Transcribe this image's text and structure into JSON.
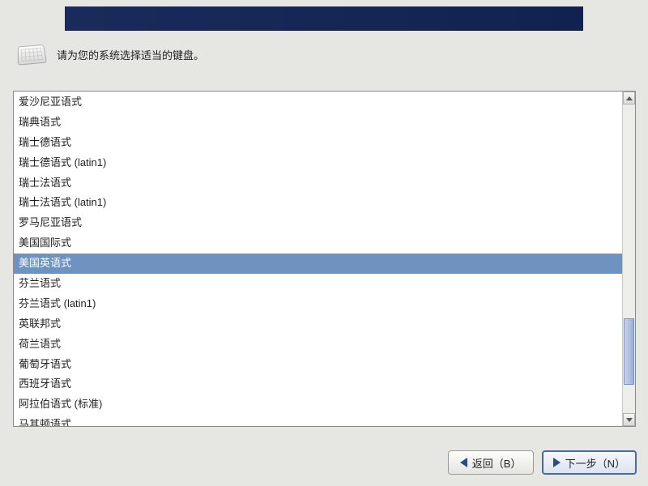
{
  "header": {
    "title": ""
  },
  "prompt": "请为您的系统选择适当的键盘。",
  "keyboard_list": {
    "selected_index": 8,
    "items": [
      "爱沙尼亚语式",
      "瑞典语式",
      "瑞士德语式",
      "瑞士德语式 (latin1)",
      "瑞士法语式",
      "瑞士法语式 (latin1)",
      "罗马尼亚语式",
      "美国国际式",
      "美国英语式",
      "芬兰语式",
      "芬兰语式 (latin1)",
      "英联邦式",
      "荷兰语式",
      "葡萄牙语式",
      "西班牙语式",
      "阿拉伯语式 (标准)",
      "马其顿语式"
    ]
  },
  "buttons": {
    "back": "返回（B）",
    "next": "下一步（N）"
  }
}
